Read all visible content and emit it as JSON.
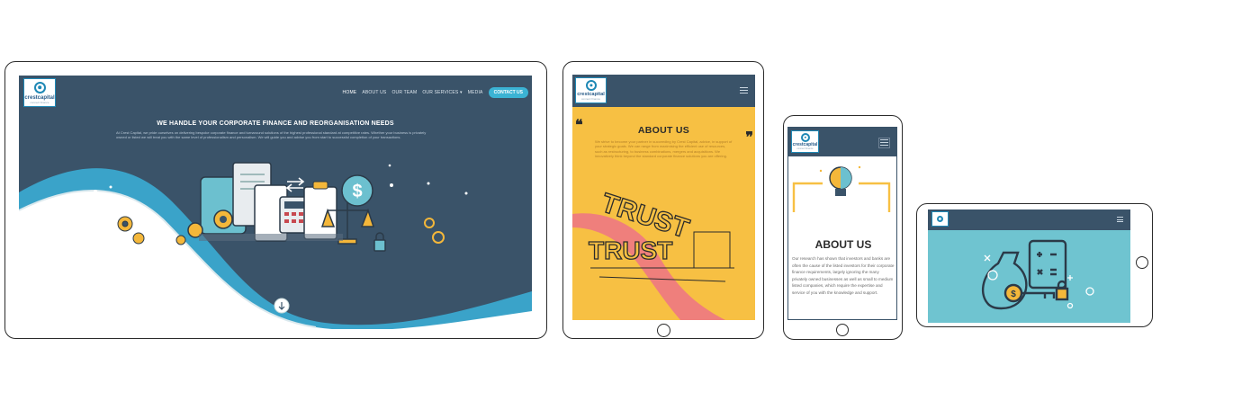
{
  "brand": {
    "name": "crestcapital",
    "tagline": "connect finance"
  },
  "laptop": {
    "nav": {
      "items": [
        "HOME",
        "ABOUT US",
        "OUR TEAM",
        "OUR SERVICES ▾",
        "MEDIA"
      ],
      "cta": "CONTACT US"
    },
    "hero": {
      "title": "WE HANDLE YOUR CORPORATE FINANCE AND REORGANISATION NEEDS",
      "body": "At Crest Capital, we pride ourselves on delivering bespoke corporate finance and turnaround solutions of the highest professional standard at competitive rates. Whether your business is privately owned or listed we will treat you with the same level of professionalism and personalism. We will guide you and advise you from start to successful completion of your transactions."
    }
  },
  "tablet": {
    "about_title": "ABOUT US",
    "about_body": "We strive to become your partner in succeeding by Crest Capital, advice, in support of your strategic goals. We can range from maximising the efficient use of resources, such as restructuring, to business combinations, mergers and acquisitions. We innovatively think beyond the standard corporate finance solutions you are offering.",
    "quote_open": "❝",
    "quote_close": "❞",
    "trust_word": "TRUST"
  },
  "phone": {
    "about_title": "ABOUT US",
    "about_body": "Our research has shown that investors and banks are often the cause of the listed investors for their corporate finance requirements, largely ignoring the many privately owned businesses as well as small to medium listed companies, which require the expertise and service of you with the knowledge and support."
  },
  "colors": {
    "navy": "#3a5369",
    "yellow": "#f7c043",
    "teal": "#6fc4d0",
    "accent": "#3bb3d4",
    "wave": "#3aa3c9"
  },
  "icons": [
    "dollar-icon",
    "calculator-icon",
    "scales-icon",
    "gear-icon",
    "lightbulb-icon",
    "money-bag-icon",
    "key-icon",
    "lock-icon",
    "hamburger-icon",
    "down-arrow-icon"
  ]
}
